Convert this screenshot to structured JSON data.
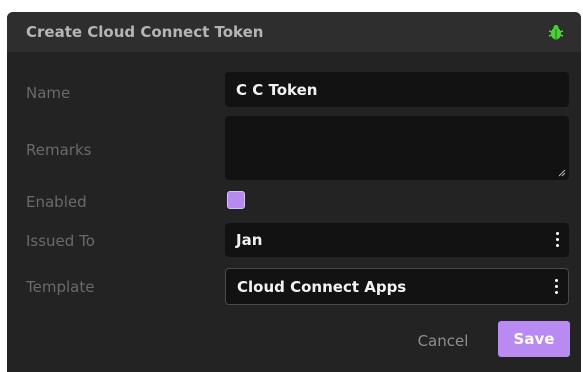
{
  "dialog": {
    "title": "Create Cloud Connect Token",
    "title_icon": "bug-icon",
    "accent_color": "#b98af2"
  },
  "form": {
    "name": {
      "label": "Name",
      "value": "C C Token"
    },
    "remarks": {
      "label": "Remarks",
      "value": ""
    },
    "enabled": {
      "label": "Enabled",
      "checked": true
    },
    "issued_to": {
      "label": "Issued To",
      "value": "Jan"
    },
    "template": {
      "label": "Template",
      "value": "Cloud Connect Apps"
    }
  },
  "actions": {
    "cancel_label": "Cancel",
    "save_label": "Save"
  }
}
